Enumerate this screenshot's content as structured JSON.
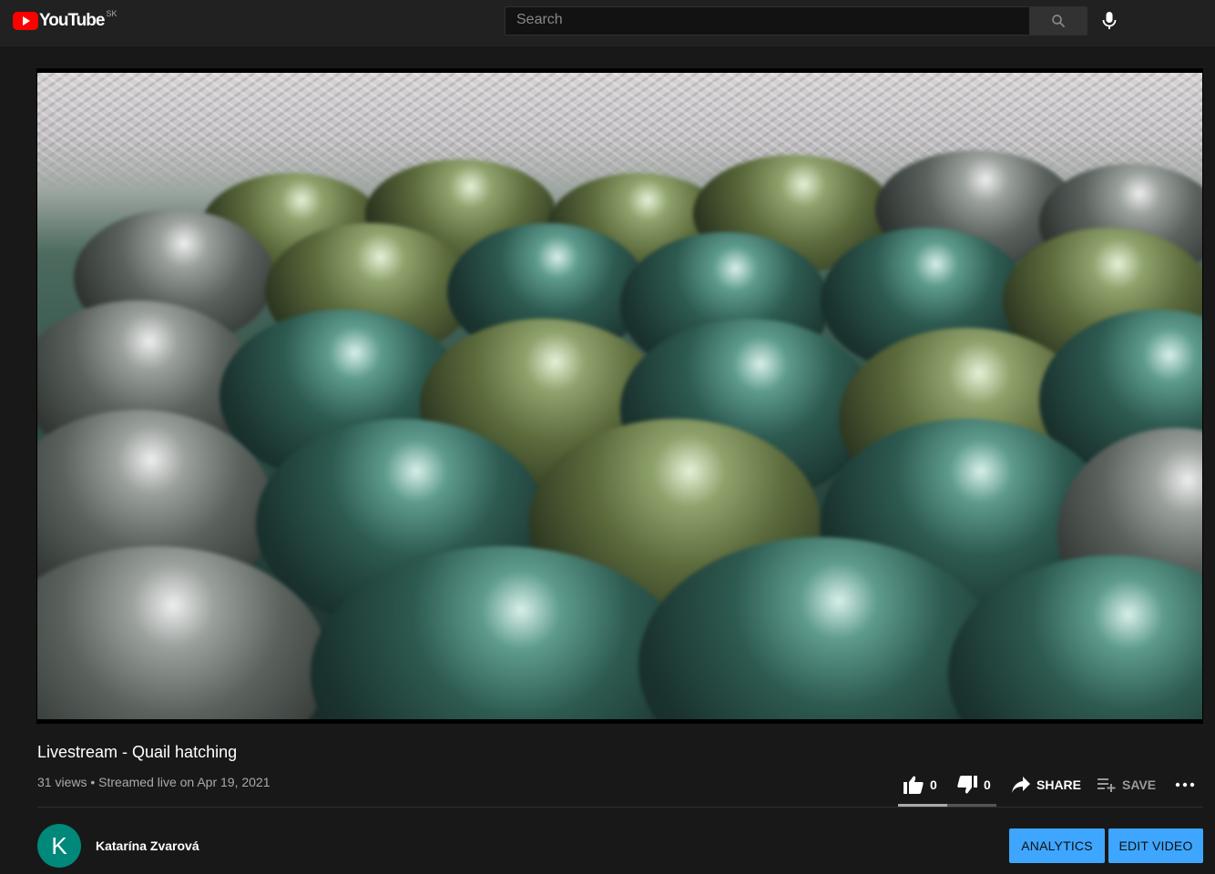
{
  "masthead": {
    "logo_text": "YouTube",
    "country_code": "SK",
    "search_placeholder": "Search"
  },
  "video": {
    "title": "Livestream - Quail hatching",
    "views": "31 views",
    "separator": "•",
    "streamed": "Streamed live on Apr 19, 2021",
    "likes": "0",
    "dislikes": "0",
    "share_label": "SHARE",
    "save_label": "SAVE",
    "sentiment_fraction": 0.5
  },
  "channel": {
    "avatar_letter": "K",
    "name": "Katarína Zvarová"
  },
  "buttons": {
    "analytics": "ANALYTICS",
    "edit_video": "EDIT VIDEO"
  },
  "colors": {
    "accent": "#3ea6ff",
    "brand_red": "#ff0000",
    "avatar_bg": "#00897b"
  },
  "icons": [
    "youtube-logo-icon",
    "search-icon",
    "microphone-icon",
    "thumb-up-icon",
    "thumb-down-icon",
    "share-icon",
    "playlist-add-icon",
    "more-icon"
  ]
}
